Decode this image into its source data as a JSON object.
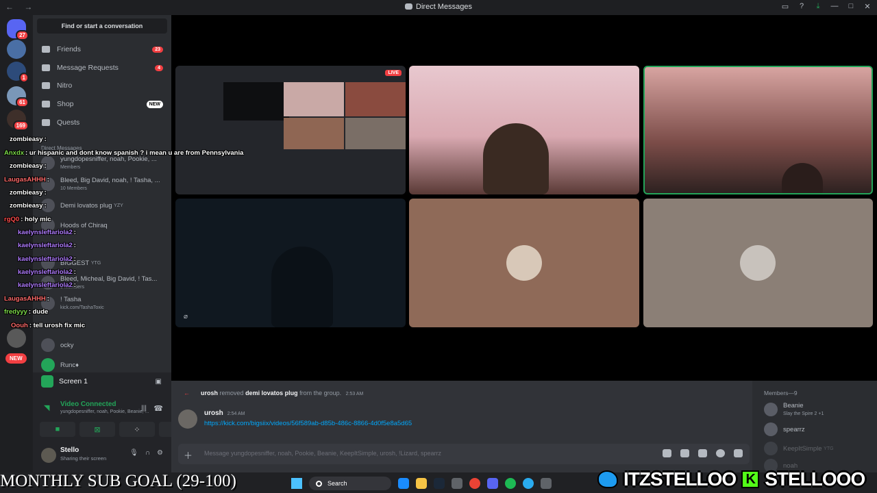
{
  "window": {
    "title": "Direct Messages",
    "nav": "← →"
  },
  "servers": [
    {
      "badge": "27"
    },
    {
      "badge": ""
    },
    {
      "badge": "1"
    },
    {
      "badge": "61"
    },
    {
      "badge": "169"
    }
  ],
  "servers_new": "NEW",
  "sidebar": {
    "find": "Find or start a conversation",
    "nav": [
      {
        "label": "Friends",
        "badge": "23"
      },
      {
        "label": "Message Requests",
        "badge": "4"
      },
      {
        "label": "Nitro",
        "badge": ""
      },
      {
        "label": "Shop",
        "badge": "NEW"
      },
      {
        "label": "Quests",
        "badge": ""
      }
    ],
    "dm_header": "Direct Messages",
    "dms": [
      {
        "name": "yungdopesniffer, noah, Pookie, ...",
        "sub": "Members"
      },
      {
        "name": "Bleed, Big David, noah, ! Tasha, ...",
        "sub": "10 Members"
      },
      {
        "name": "Demi lovatos plug",
        "sub": "YZY"
      },
      {
        "name": "Hoods of Chiraq",
        "sub": ""
      },
      {
        "name": "BIGGEST",
        "sub": "YTG"
      },
      {
        "name": "Bleed, Micheal, Big David, ! Tas...",
        "sub": "9 Members"
      },
      {
        "name": "! Tasha",
        "sub": "kick.com/TashaToxic"
      },
      {
        "name": "ocky",
        "sub": ""
      },
      {
        "name": "Runc♦",
        "sub": ""
      }
    ]
  },
  "voice": {
    "screen": "Screen 1",
    "status": "Video Connected",
    "members": "yungdopesniffer, noah, Pookie, Beanie, ..."
  },
  "user": {
    "name": "Stello",
    "status": "Sharing their screen"
  },
  "stage": {
    "live": "LIVE",
    "screen_label": "Screen 1"
  },
  "chat": {
    "sys_author": "urosh",
    "sys_action": "removed",
    "sys_target": "demi lovatos plug",
    "sys_suffix": "from the group.",
    "sys_time": "2:53 AM",
    "msg_author": "urosh",
    "msg_time": "2:54 AM",
    "msg_link": "https://kick.com/bigsiix/videos/56f589ab-d85b-486c-8866-4d0f5e8a5d65",
    "placeholder": "Message yungdopesniffer, noah, Pookie, Beanie, KeepItSimple, urosh, !Lizard, spearrz"
  },
  "members": {
    "header": "Members—9",
    "list": [
      {
        "name": "Beanie",
        "activity": "Slay the Spire 2 +1"
      },
      {
        "name": "spearrz",
        "activity": ""
      },
      {
        "name": "KeepItSimple",
        "activity": "YTG"
      },
      {
        "name": "noah",
        "activity": ""
      }
    ]
  },
  "stream_chat": [
    {
      "user": "zombieasy",
      "text": ":",
      "color": "#ffffff"
    },
    {
      "user": "Anxdx",
      "text": ": ur hispanic and dont know spanish ? i mean u are from Pennsylvania",
      "color": "#7ddc4a"
    },
    {
      "user": "zombieasy",
      "text": ":",
      "color": "#ffffff"
    },
    {
      "user": "LaugasAHHH",
      "text": ":",
      "color": "#ff6b6b"
    },
    {
      "user": "zombieasy",
      "text": ":",
      "color": "#ffffff"
    },
    {
      "user": "zombieasy",
      "text": ":",
      "color": "#ffffff"
    },
    {
      "user": "rgQ0",
      "text": ": holy mic",
      "color": "#ff4d4d"
    },
    {
      "user": "kaelynsleftariola2",
      "text": ":",
      "color": "#b07cff"
    },
    {
      "user": "kaelynsleftariola2",
      "text": ":",
      "color": "#b07cff"
    },
    {
      "user": "kaelynsleftariola2",
      "text": ":",
      "color": "#b07cff"
    },
    {
      "user": "kaelynsleftariola2",
      "text": ":",
      "color": "#b07cff"
    },
    {
      "user": "kaelynsleftariola2",
      "text": ":",
      "color": "#b07cff"
    },
    {
      "user": "LaugasAHHH",
      "text": ":",
      "color": "#ff6b6b"
    },
    {
      "user": "fredyyy",
      "text": ": dude",
      "color": "#7ddc4a"
    },
    {
      "user": "Oouh",
      "text": ": tell urosh fix mic",
      "color": "#ff6b6b"
    }
  ],
  "taskbar": {
    "search": "Search"
  },
  "overlay": {
    "goal": "MONTHLY SUB GOAL (29-100)",
    "twitter": "ITZSTELLOO",
    "kick": "STELLOOO",
    "kick_letter": "K"
  },
  "colors": {
    "accent": "#5865f2",
    "green": "#23a559",
    "link": "#00a8fc",
    "danger": "#f23f42"
  }
}
